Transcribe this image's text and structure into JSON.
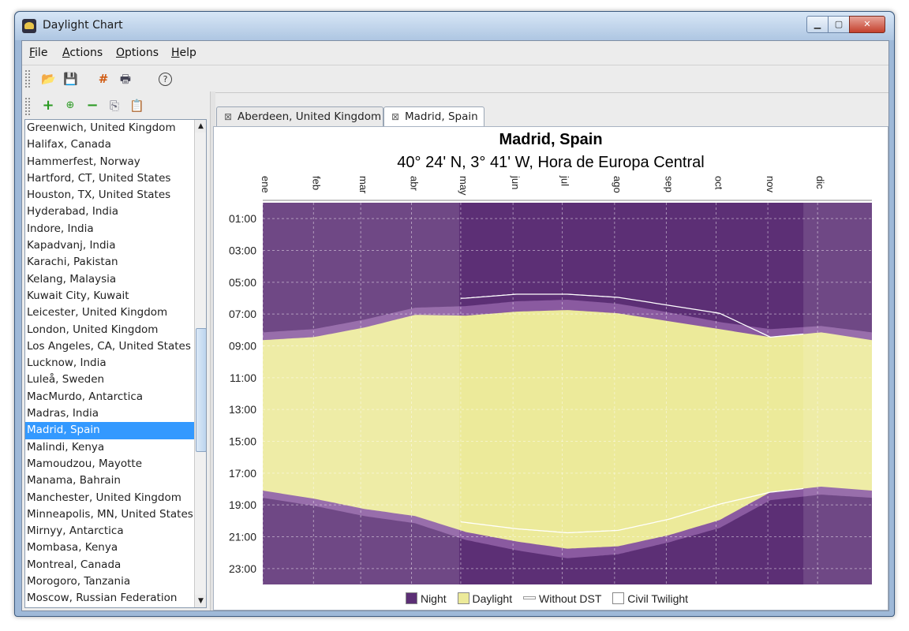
{
  "window": {
    "title": "Daylight Chart"
  },
  "menu": [
    "File",
    "Actions",
    "Options",
    "Help"
  ],
  "toolbar": {
    "main_icons": [
      "open-folder-icon",
      "save-icon",
      "grid-icon",
      "print-icon",
      "help-icon"
    ],
    "list_icons": [
      "add-icon",
      "add-multiple-icon",
      "remove-icon",
      "copy-icon",
      "paste-icon"
    ]
  },
  "locations": [
    "Greenwich, United Kingdom",
    "Halifax, Canada",
    "Hammerfest, Norway",
    "Hartford, CT, United States",
    "Houston, TX, United States",
    "Hyderabad, India",
    "Indore, India",
    "Kapadvanj, India",
    "Karachi, Pakistan",
    "Kelang, Malaysia",
    "Kuwait City, Kuwait",
    "Leicester, United Kingdom",
    "London, United Kingdom",
    "Los Angeles, CA, United States",
    "Lucknow, India",
    "Luleå, Sweden",
    "MacMurdo, Antarctica",
    "Madras, India",
    "Madrid, Spain",
    "Malindi, Kenya",
    "Mamoudzou, Mayotte",
    "Manama, Bahrain",
    "Manchester, United Kingdom",
    "Minneapolis, MN, United States",
    "Mirnyy, Antarctica",
    "Mombasa, Kenya",
    "Montreal, Canada",
    "Morogoro, Tanzania",
    "Moscow, Russian Federation"
  ],
  "selected_location": "Madrid, Spain",
  "tabs": [
    {
      "label": "Aberdeen, United Kingdom",
      "active": false
    },
    {
      "label": "Madrid, Spain",
      "active": true
    }
  ],
  "chart_data": {
    "type": "area",
    "title": "Madrid, Spain",
    "subtitle": "40° 24' N, 3° 41' W, Hora de Europa Central",
    "months": [
      "ene",
      "feb",
      "mar",
      "abr",
      "may",
      "jun",
      "jul",
      "ago",
      "sep",
      "oct",
      "nov",
      "dic"
    ],
    "y_ticks": [
      "01:00",
      "03:00",
      "05:00",
      "07:00",
      "09:00",
      "11:00",
      "13:00",
      "15:00",
      "17:00",
      "19:00",
      "21:00",
      "23:00"
    ],
    "ylim": [
      "00:00",
      "24:00"
    ],
    "grid": true,
    "dst_period_months": [
      3.87,
      10.65
    ],
    "series": [
      {
        "name": "Daylight",
        "sunrise_hours": [
          8.64,
          8.45,
          7.85,
          7.05,
          7.1,
          6.85,
          6.75,
          6.95,
          7.45,
          7.95,
          8.45,
          8.15,
          8.64
        ],
        "sunset_hours": [
          18.1,
          18.6,
          19.25,
          19.7,
          20.7,
          21.3,
          21.75,
          21.6,
          20.9,
          19.95,
          18.2,
          17.85,
          18.1
        ]
      },
      {
        "name": "Civil Twilight",
        "dawn_hours": [
          8.15,
          7.95,
          7.35,
          6.6,
          6.5,
          6.2,
          6.1,
          6.35,
          6.9,
          7.5,
          7.95,
          7.75,
          8.15
        ],
        "dusk_hours": [
          18.55,
          19.05,
          19.7,
          20.15,
          21.2,
          21.85,
          22.35,
          22.1,
          21.35,
          20.45,
          18.7,
          18.35,
          18.55
        ]
      },
      {
        "name": "Without DST",
        "sunrise_hours": [
          8.64,
          8.45,
          7.85,
          6.1,
          6.0,
          5.75,
          5.75,
          5.95,
          6.45,
          6.95,
          8.45,
          8.15,
          8.64
        ],
        "sunset_hours": [
          18.1,
          18.6,
          19.25,
          19.75,
          20.1,
          20.5,
          20.75,
          20.6,
          19.9,
          18.95,
          18.2,
          17.85,
          18.1
        ]
      },
      {
        "name": "Night"
      }
    ],
    "colors": {
      "Night": "#5c2f75",
      "Daylight": "#ecea9a",
      "Civil Twilight": "#8a5aa0",
      "Without DST": "#ffffff"
    },
    "legend": [
      "Night",
      "Daylight",
      "Without DST",
      "Civil Twilight"
    ],
    "legend_position": "bottom"
  }
}
